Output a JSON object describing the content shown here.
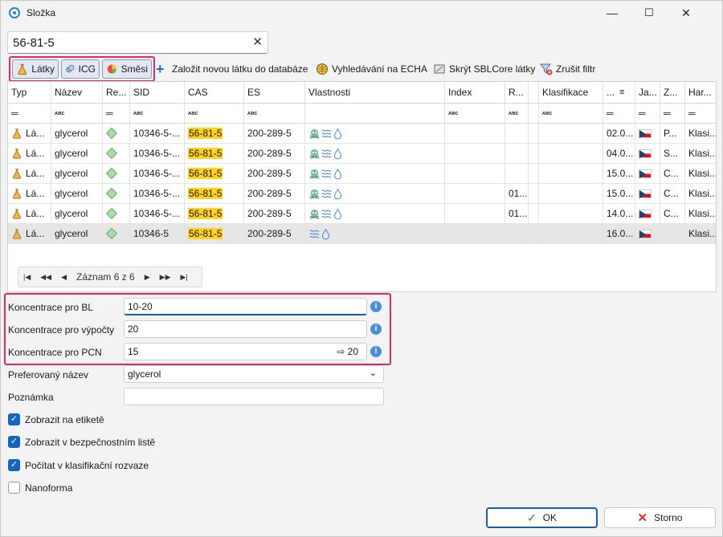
{
  "window": {
    "title": "Složka",
    "minimize": "—",
    "maximize": "☐",
    "close": "✕"
  },
  "search": {
    "value": "56-81-5",
    "clear": "✕"
  },
  "toolbar": {
    "toggles": [
      "Látky",
      "ICG",
      "Směsi"
    ],
    "add_label": "Založit novou látku do databáze",
    "echa_label": "Vyhledávání na ECHA",
    "hide_label": "Skrýt SBLCore látky",
    "cancel_filter_label": "Zrušit filtr"
  },
  "grid": {
    "columns": [
      "Typ",
      "Název",
      "Re...",
      "SID",
      "CAS",
      "ES",
      "Vlastnosti",
      "Index",
      "R...",
      "",
      "Klasifikace",
      "...",
      "Ja...",
      "Z...",
      "Har..."
    ],
    "filter_eq": "═",
    "filter_abc": "ᴀʙᴄ",
    "rows": [
      {
        "typ": "Lá...",
        "nazev": "glycerol",
        "sid": "10346-5-...",
        "cas": "56-81-5",
        "es": "200-289-5",
        "r": "",
        "date": "02.0...",
        "z": "P...",
        "har": "Klasi..."
      },
      {
        "typ": "Lá...",
        "nazev": "glycerol",
        "sid": "10346-5-...",
        "cas": "56-81-5",
        "es": "200-289-5",
        "r": "",
        "date": "04.0...",
        "z": "S...",
        "har": "Klasi..."
      },
      {
        "typ": "Lá...",
        "nazev": "glycerol",
        "sid": "10346-5-...",
        "cas": "56-81-5",
        "es": "200-289-5",
        "r": "",
        "date": "15.0...",
        "z": "C...",
        "har": "Klasi..."
      },
      {
        "typ": "Lá...",
        "nazev": "glycerol",
        "sid": "10346-5-...",
        "cas": "56-81-5",
        "es": "200-289-5",
        "r": "01...",
        "date": "15.0...",
        "z": "C...",
        "har": "Klasi..."
      },
      {
        "typ": "Lá...",
        "nazev": "glycerol",
        "sid": "10346-5-...",
        "cas": "56-81-5",
        "es": "200-289-5",
        "r": "01...",
        "date": "14.0...",
        "z": "C...",
        "har": "Klasi..."
      },
      {
        "typ": "Lá...",
        "nazev": "glycerol",
        "sid": "10346-5",
        "cas": "56-81-5",
        "es": "200-289-5",
        "r": "",
        "date": "16.0...",
        "z": "",
        "har": "Klasi..."
      }
    ],
    "pager": {
      "first": "|◀",
      "prev_page": "◀◀",
      "prev": "◀",
      "text": "Záznam 6 z 6",
      "next": "▶",
      "next_page": "▶▶",
      "last": "▶|"
    }
  },
  "form": {
    "bl_label": "Koncentrace pro BL",
    "bl_value": "10-20",
    "calc_label": "Koncentrace pro výpočty",
    "calc_value": "20",
    "pcn_label": "Koncentrace pro PCN",
    "pcn_value": "15",
    "pcn_arrow": "⇨ 20",
    "name_label": "Preferovaný název",
    "name_value": "glycerol",
    "note_label": "Poznámka",
    "note_value": "",
    "info": "i"
  },
  "checks": [
    {
      "label": "Zobrazit na etiketě",
      "checked": true
    },
    {
      "label": "Zobrazit v bezpečnostním listě",
      "checked": true
    },
    {
      "label": "Počítat v klasifikační rozvaze",
      "checked": true
    },
    {
      "label": "Nanoforma",
      "checked": false
    }
  ],
  "buttons": {
    "ok": "OK",
    "cancel": "Storno"
  }
}
